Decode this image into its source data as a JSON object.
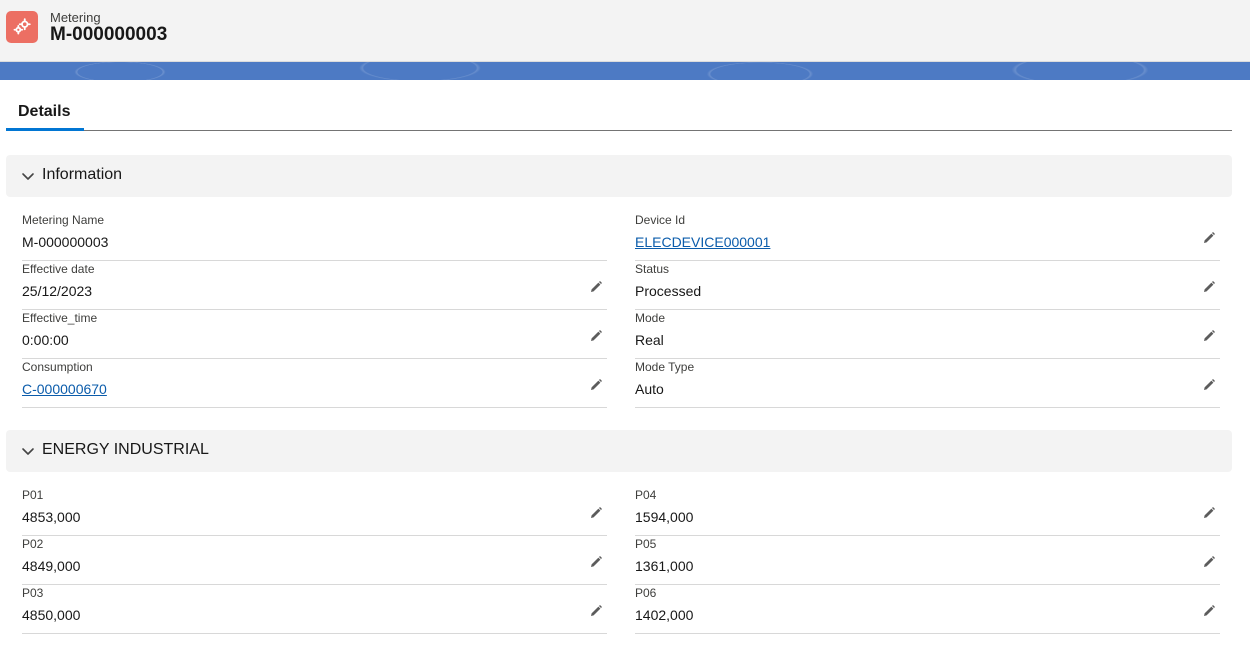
{
  "header": {
    "object_type": "Metering",
    "record_name": "M-000000003",
    "icon": "gears-icon",
    "icon_color": "#ec6f63"
  },
  "tabs": [
    {
      "label": "Details",
      "active": true
    }
  ],
  "sections": [
    {
      "title": "Information",
      "left": [
        {
          "label": "Metering Name",
          "value": "M-000000003",
          "link": false,
          "editable": false
        },
        {
          "label": "Effective date",
          "value": "25/12/2023",
          "link": false,
          "editable": true
        },
        {
          "label": "Effective_time",
          "value": "0:00:00",
          "link": false,
          "editable": true
        },
        {
          "label": "Consumption",
          "value": "C-000000670",
          "link": true,
          "editable": true
        }
      ],
      "right": [
        {
          "label": "Device Id",
          "value": "ELECDEVICE000001",
          "link": true,
          "editable": true
        },
        {
          "label": "Status",
          "value": "Processed",
          "link": false,
          "editable": true
        },
        {
          "label": "Mode",
          "value": "Real",
          "link": false,
          "editable": true
        },
        {
          "label": "Mode Type",
          "value": "Auto",
          "link": false,
          "editable": true
        }
      ]
    },
    {
      "title": "ENERGY INDUSTRIAL",
      "left": [
        {
          "label": "P01",
          "value": "4853,000",
          "link": false,
          "editable": true
        },
        {
          "label": "P02",
          "value": "4849,000",
          "link": false,
          "editable": true
        },
        {
          "label": "P03",
          "value": "4850,000",
          "link": false,
          "editable": true
        }
      ],
      "right": [
        {
          "label": "P04",
          "value": "1594,000",
          "link": false,
          "editable": true
        },
        {
          "label": "P05",
          "value": "1361,000",
          "link": false,
          "editable": true
        },
        {
          "label": "P06",
          "value": "1402,000",
          "link": false,
          "editable": true
        }
      ]
    }
  ],
  "colors": {
    "link": "#0b5cab",
    "tab_accent": "#0176d3",
    "banner": "#4d7ac4"
  }
}
